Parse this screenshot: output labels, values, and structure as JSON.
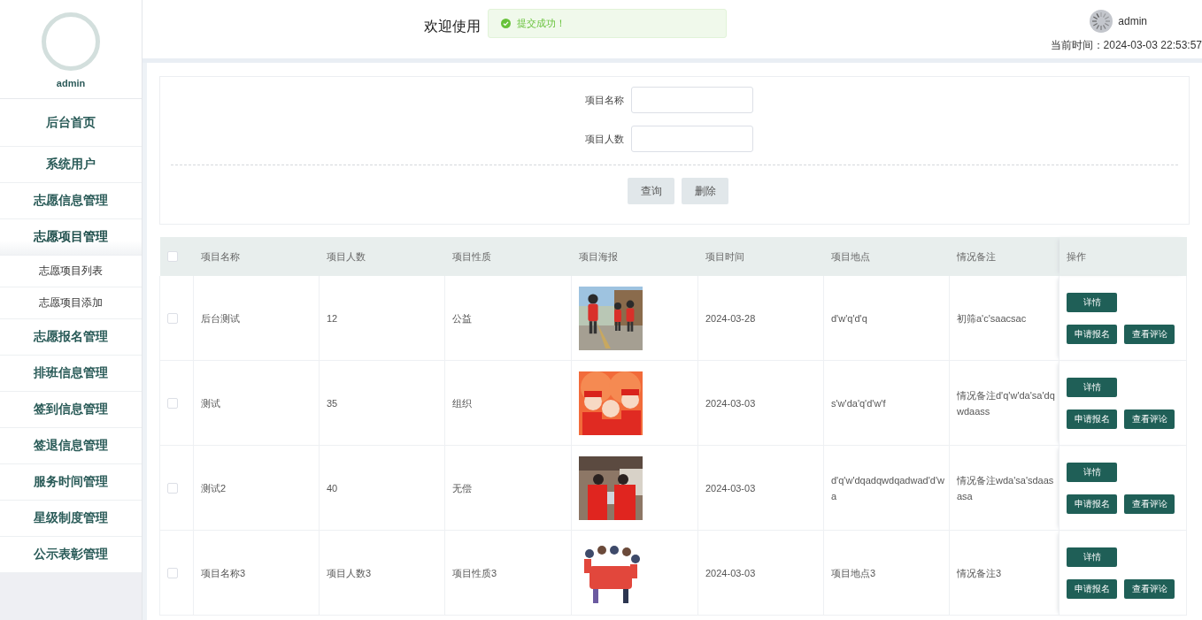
{
  "sidebar": {
    "user": "admin",
    "menu": [
      {
        "label": "后台首页",
        "kind": "home"
      },
      {
        "label": "系统用户",
        "kind": "group"
      },
      {
        "label": "志愿信息管理",
        "kind": "group"
      },
      {
        "label": "志愿项目管理",
        "kind": "group",
        "expanded": true,
        "children": [
          {
            "label": "志愿项目列表",
            "kind": "sub"
          },
          {
            "label": "志愿项目添加",
            "kind": "sub"
          }
        ]
      },
      {
        "label": "志愿报名管理",
        "kind": "group"
      },
      {
        "label": "排班信息管理",
        "kind": "group"
      },
      {
        "label": "签到信息管理",
        "kind": "group"
      },
      {
        "label": "签退信息管理",
        "kind": "group"
      },
      {
        "label": "服务时间管理",
        "kind": "group"
      },
      {
        "label": "星级制度管理",
        "kind": "group"
      },
      {
        "label": "公示表彰管理",
        "kind": "group"
      }
    ]
  },
  "header": {
    "title": "欢迎使用",
    "user": "admin",
    "time_label": "当前时间：2024-03-03 22:53:57"
  },
  "toast": {
    "kind": "success",
    "message": "提交成功！"
  },
  "search": {
    "fields": [
      {
        "label": "项目名称"
      },
      {
        "label": "项目人数"
      }
    ],
    "buttons": [
      "查询",
      "删除"
    ]
  },
  "table": {
    "select_all": {
      "checked": false
    },
    "columns": [
      "项目名称",
      "项目人数",
      "项目性质",
      "项目海报",
      "项目时间",
      "项目地点",
      "情况备注",
      "操作"
    ],
    "rows": [
      {
        "checked": false,
        "cells": [
          "后台测试",
          "12",
          "公益"
        ],
        "poster": {
          "kind": "picture"
        },
        "rest": [
          "2024-03-28",
          "d'w'q'd'q",
          "初筛a'c'saacsac"
        ],
        "actions": [
          "详情",
          "申请报名",
          "查看评论"
        ]
      },
      {
        "checked": false,
        "cells": [
          "测试",
          "35",
          "组织"
        ],
        "poster": {
          "kind": "picture"
        },
        "rest": [
          "2024-03-03",
          "s'w'da'q'd'w'f",
          "情况备注d'q'w'da'sa'dqwdaass"
        ],
        "actions": [
          "详情",
          "申请报名",
          "查看评论"
        ]
      },
      {
        "checked": false,
        "cells": [
          "测试2",
          "40",
          "无偿"
        ],
        "poster": {
          "kind": "picture"
        },
        "rest": [
          "2024-03-03",
          "d'q'w'dqadqwdqadwad'd'wa",
          "情况备注wda'sa'sdaasasa"
        ],
        "actions": [
          "详情",
          "申请报名",
          "查看评论"
        ]
      },
      {
        "checked": false,
        "cells": [
          "项目名称3",
          "项目人数3",
          "项目性质3"
        ],
        "poster": {
          "kind": "picture"
        },
        "rest": [
          "2024-03-03",
          "项目地点3",
          "情况备注3"
        ],
        "actions": [
          "详情",
          "申请报名",
          "查看评论"
        ]
      }
    ]
  }
}
